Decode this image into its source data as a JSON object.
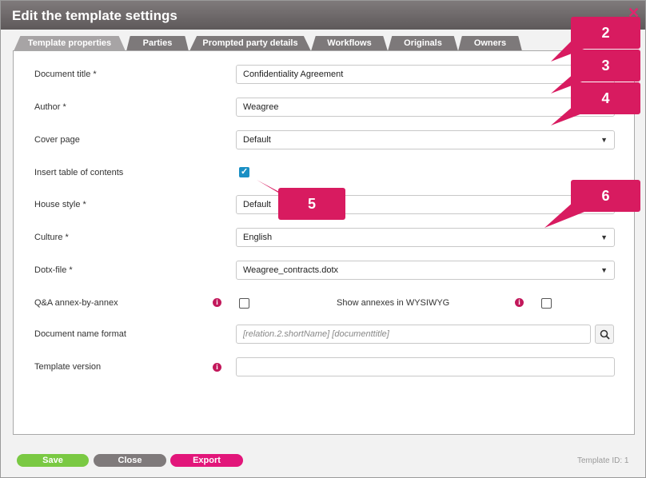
{
  "dialog": {
    "title": "Edit the template settings"
  },
  "tabs": [
    {
      "label": "Template properties"
    },
    {
      "label": "Parties"
    },
    {
      "label": "Prompted party details"
    },
    {
      "label": "Workflows"
    },
    {
      "label": "Originals"
    },
    {
      "label": "Owners"
    }
  ],
  "form": {
    "document_title": {
      "label": "Document title *",
      "value": "Confidentiality Agreement"
    },
    "author": {
      "label": "Author *",
      "value": "Weagree"
    },
    "cover_page": {
      "label": "Cover page",
      "value": "Default"
    },
    "insert_toc": {
      "label": "Insert table of contents",
      "checked": true
    },
    "house_style": {
      "label": "House style *",
      "value": "Default"
    },
    "culture": {
      "label": "Culture *",
      "value": "English"
    },
    "dotx_file": {
      "label": "Dotx-file *",
      "value": "Weagree_contracts.dotx"
    },
    "qa_annex": {
      "label": "Q&A annex-by-annex",
      "checked": false
    },
    "show_annexes": {
      "label": "Show annexes in WYSIWYG",
      "checked": false
    },
    "doc_name_format": {
      "label": "Document name format",
      "value": "[relation.2.shortName] [documenttitle]"
    },
    "template_version": {
      "label": "Template version",
      "value": ""
    }
  },
  "callouts": [
    "2",
    "3",
    "4",
    "5",
    "6"
  ],
  "footer": {
    "save": "Save",
    "close": "Close",
    "export": "Export",
    "template_id_label": "Template ID:",
    "template_id_value": "1"
  },
  "colors": {
    "save": "#7ac943",
    "close": "#7f7a7b",
    "export": "#e2167a",
    "callout": "#d81b60",
    "checkbox": "#1a8fc4",
    "info_icon": "#c2185b"
  }
}
